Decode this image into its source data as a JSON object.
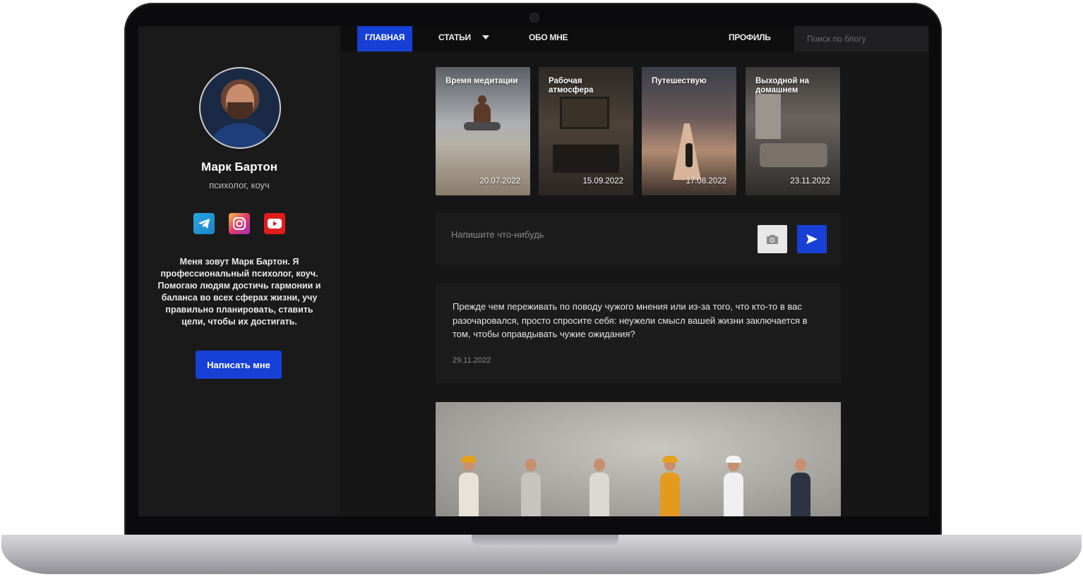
{
  "nav": {
    "items": [
      "ГЛАВНАЯ",
      "СТАТЬИ",
      "ОБО МНЕ",
      "ПРОФИЛЬ"
    ],
    "active": "ГЛАВНАЯ",
    "search_placeholder": "Поиск по блогу"
  },
  "sidebar": {
    "name": "Марк Бартон",
    "role": "психолог, коуч",
    "socials": [
      "telegram-icon",
      "instagram-icon",
      "youtube-icon"
    ],
    "bio": "Меня зовут Марк Бартон. Я профессиональный психолог, коуч. Помогаю людям достичь гармонии и баланса во всех сферах жизни, учу правильно планировать, ставить цели, чтобы их достигать.",
    "cta_label": "Написать мне"
  },
  "stories": [
    {
      "title": "Время медитации",
      "date": "20.07.2022"
    },
    {
      "title": "Рабочая атмосфера",
      "date": "15.09.2022"
    },
    {
      "title": "Путешествую",
      "date": "17.08.2022"
    },
    {
      "title": "Выходной на домашнем",
      "date": "23.11.2022"
    }
  ],
  "composer": {
    "placeholder": "Напишите что-нибудь"
  },
  "post": {
    "text": "Прежде чем переживать по поводу чужого мнения или из-за того, что кто-то в вас разочаровался, просто спросите себя: неужели смысл вашей жизни заключается в том, чтобы оправдывать чужие ожидания?",
    "date": "29.11.2022"
  },
  "colors": {
    "accent": "#1640d6",
    "background": "#161617",
    "sidebar": "#1a1a1b",
    "card": "#1c1c1d"
  }
}
